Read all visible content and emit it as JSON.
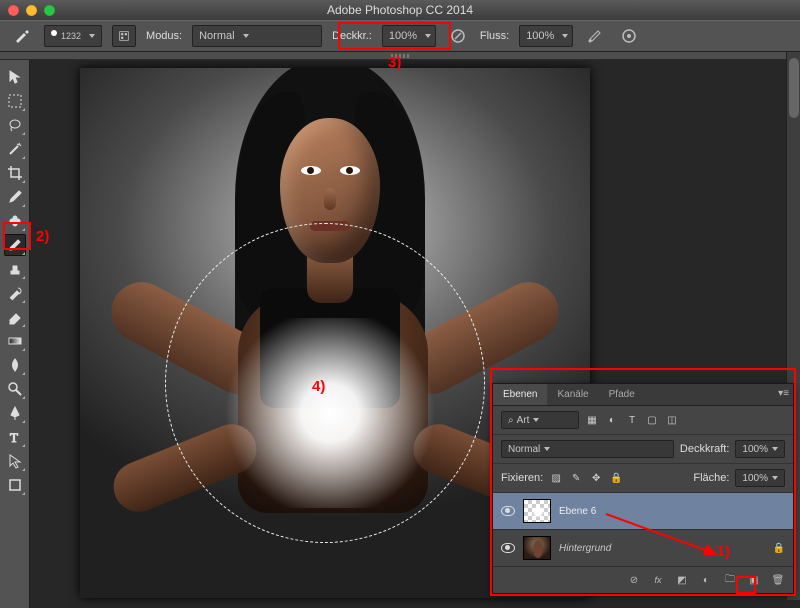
{
  "app": {
    "title": "Adobe Photoshop CC 2014"
  },
  "options": {
    "tool_glyph": "✏",
    "brush_size": "1232",
    "modus_label": "Modus:",
    "modus_value": "Normal",
    "opacity_label": "Deckkr.:",
    "opacity_value": "100%",
    "flow_label": "Fluss:",
    "flow_value": "100%"
  },
  "annotations": {
    "one": "1)",
    "two": "2)",
    "three": "3)",
    "four": "4)"
  },
  "layers_panel": {
    "tab_layers": "Ebenen",
    "tab_channels": "Kanäle",
    "tab_paths": "Pfade",
    "filter_kind": "Art",
    "blend_mode": "Normal",
    "opacity_label": "Deckkraft:",
    "opacity_value": "100%",
    "lock_label": "Fixieren:",
    "fill_label": "Fläche:",
    "fill_value": "100%",
    "layer_selected": "Ebene 6",
    "layer_bg": "Hintergrund",
    "search_icon": "⌕",
    "lock_glyph": "🔒"
  },
  "footer_icons": {
    "link": "⊘",
    "fx": "fx",
    "mask": "◩",
    "adjust": "◐",
    "group": "🗀",
    "new": "▣",
    "trash": "🗑"
  }
}
